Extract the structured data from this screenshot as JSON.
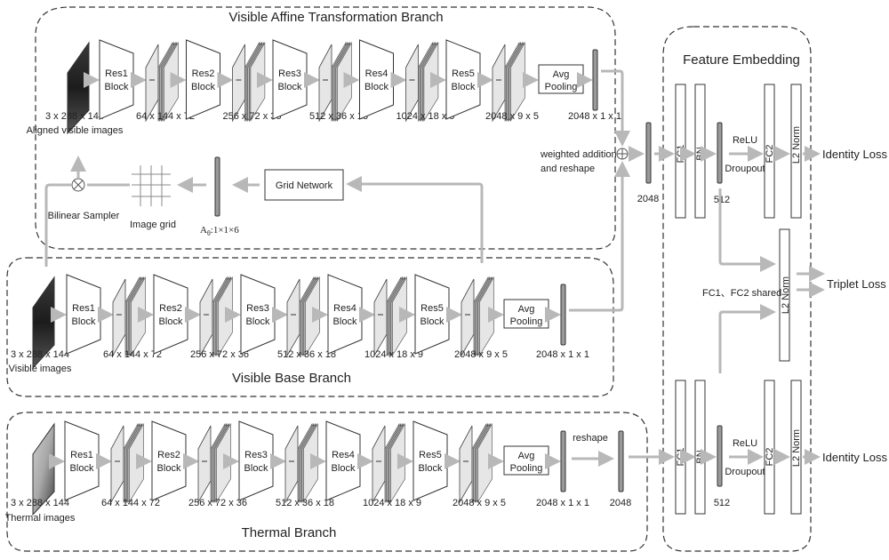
{
  "branches": {
    "affine": {
      "title": "Visible Affine Transformation Branch",
      "input_dims": "3 x 288 x 144",
      "input_label": "Aligned visible images",
      "image_kind": "visible",
      "blocks": [
        "Res1 Block",
        "Res2 Block",
        "Res3 Block",
        "Res4 Block",
        "Res5 Block"
      ],
      "feature_dims": [
        "64 x 144 x 72",
        "256 x 72 x 36",
        "512 x 36 x 18",
        "1024 x 18 x 9",
        "2048 x 9 x 5"
      ],
      "pool_label": [
        "Avg",
        "Pooling"
      ],
      "pool_dims": "2048 x 1 x 1"
    },
    "base": {
      "title": "Visible Base Branch",
      "input_dims": "3 x 288 x 144",
      "input_label": "Visible images",
      "image_kind": "visible",
      "blocks": [
        "Res1 Block",
        "Res2 Block",
        "Res3 Block",
        "Res4 Block",
        "Res5 Block"
      ],
      "feature_dims": [
        "64 x 144 x 72",
        "256 x 72 x 36",
        "512 x 36 x 18",
        "1024 x 18 x 9",
        "2048 x 9 x 5"
      ],
      "pool_label": [
        "Avg",
        "Pooling"
      ],
      "pool_dims": "2048 x 1 x 1"
    },
    "thermal": {
      "title": "Thermal Branch",
      "input_dims": "3 x 288 x 144",
      "input_label": "Thermal images",
      "image_kind": "thermal",
      "blocks": [
        "Res1 Block",
        "Res2 Block",
        "Res3 Block",
        "Res4 Block",
        "Res5 Block"
      ],
      "feature_dims": [
        "64 x 144 x 72",
        "256 x 72 x 36",
        "512 x 36 x 18",
        "1024 x 18 x 9",
        "2048 x 9 x 5"
      ],
      "pool_label": [
        "Avg",
        "Pooling"
      ],
      "pool_dims": "2048 x 1 x 1",
      "reshape_label": "reshape",
      "reshape_dims": "2048"
    }
  },
  "grid": {
    "network_label": "Grid Network",
    "theta_label": "A",
    "theta_sub": "θ",
    "theta_dims": ":1×1×6",
    "image_grid_label": "Image grid",
    "sampler_label": "Bilinear Sampler"
  },
  "fusion": {
    "label_line1": "weighted addition",
    "label_line2": "and reshape",
    "dims": "2048"
  },
  "embedding": {
    "title": "Feature Embedding",
    "fc1": "FC1",
    "bn": "BN",
    "fc2": "FC2",
    "l2": "L2 Norm",
    "relu": "ReLU",
    "dropout": "Droupout",
    "vec_dims": "512",
    "shared_note": "FC1、FC2 shared"
  },
  "losses": {
    "identity": "Identity Loss",
    "triplet": "Triplet Loss"
  },
  "colors": {
    "arrow": "#b8b8b8",
    "stroke": "#333333",
    "map_fill": "#e6e6e6",
    "vector_fill": "#9a9a9a"
  }
}
